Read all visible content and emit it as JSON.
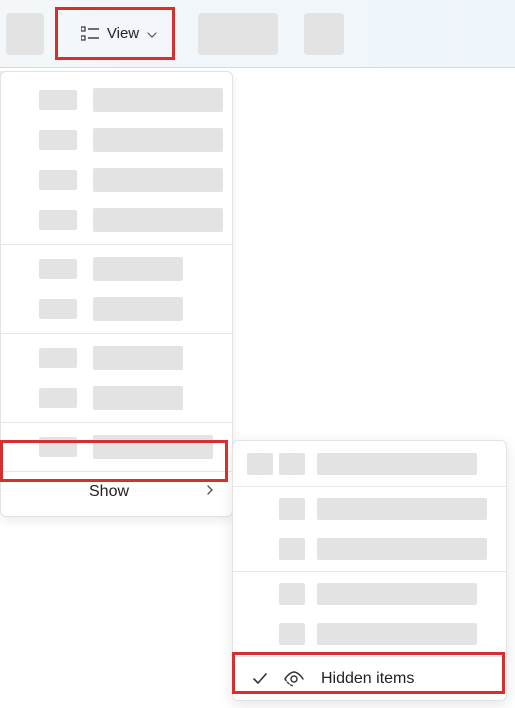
{
  "toolbar": {
    "view_label": "View"
  },
  "menu": {
    "show_label": "Show"
  },
  "submenu": {
    "hidden_items_label": "Hidden items"
  }
}
